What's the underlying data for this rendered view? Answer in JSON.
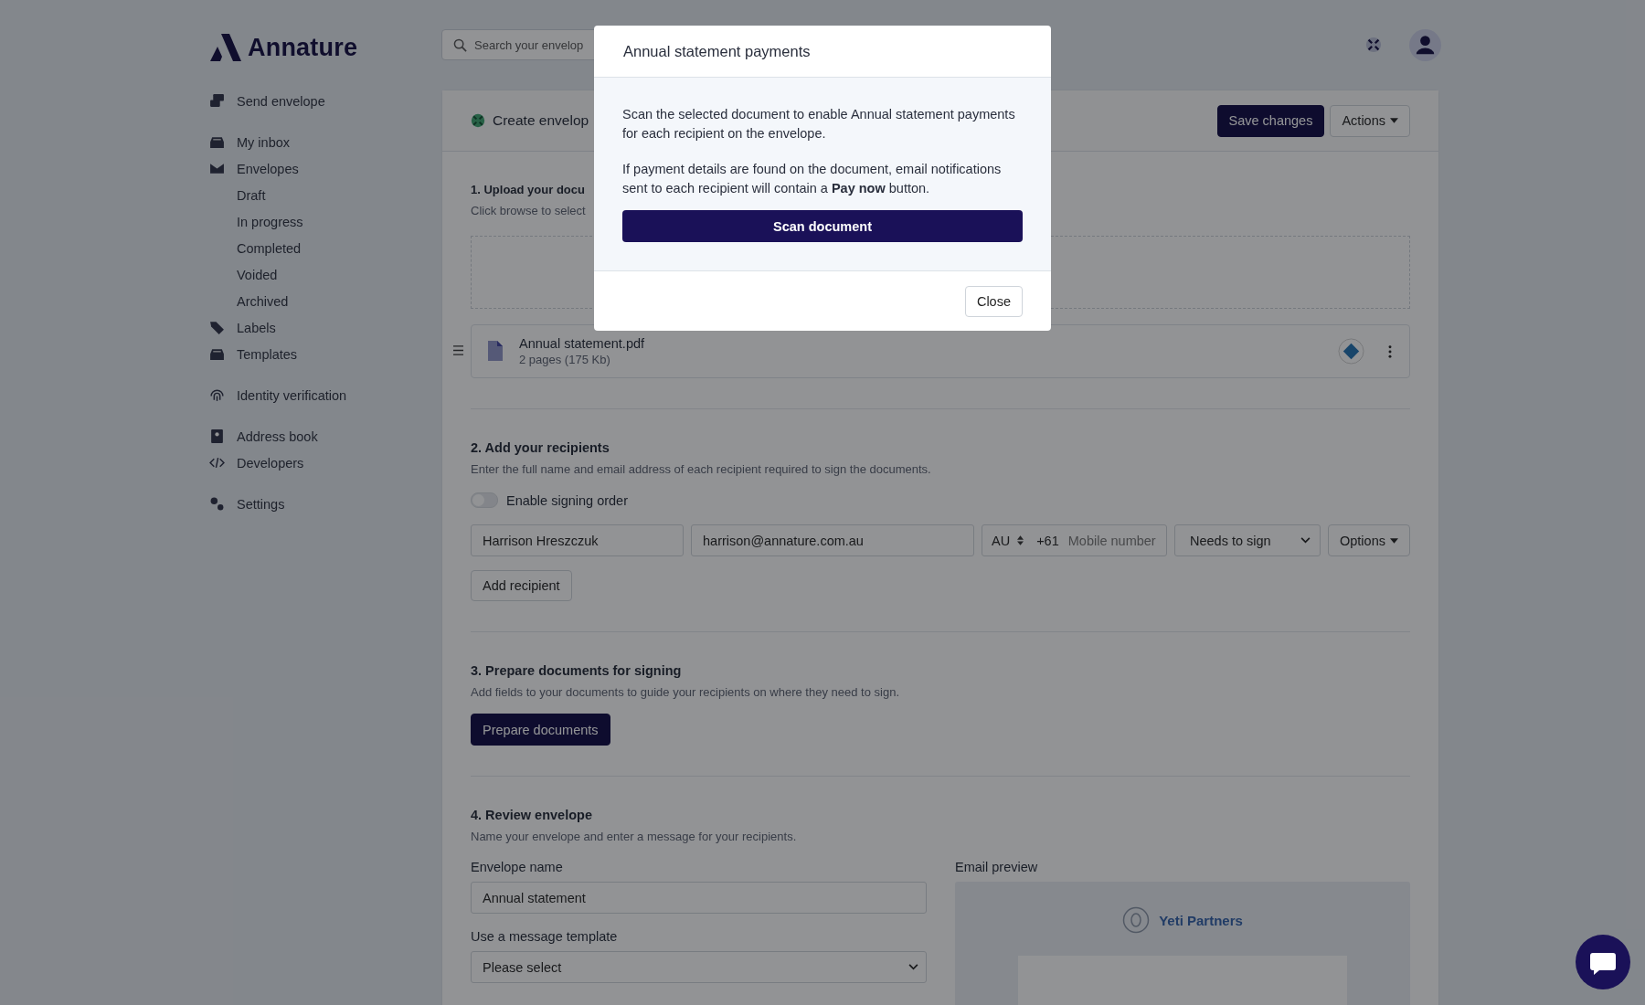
{
  "brand": {
    "name": "Annature"
  },
  "search": {
    "placeholder": "Search your envelop"
  },
  "sidebar": {
    "groups": [
      {
        "items": [
          {
            "label": "Send envelope"
          }
        ]
      },
      {
        "items": [
          {
            "label": "My inbox"
          },
          {
            "label": "Envelopes",
            "children": [
              {
                "label": "Draft"
              },
              {
                "label": "In progress"
              },
              {
                "label": "Completed"
              },
              {
                "label": "Voided"
              },
              {
                "label": "Archived"
              }
            ]
          },
          {
            "label": "Labels"
          },
          {
            "label": "Templates"
          }
        ]
      },
      {
        "items": [
          {
            "label": "Identity verification"
          }
        ]
      },
      {
        "items": [
          {
            "label": "Address book"
          },
          {
            "label": "Developers"
          }
        ]
      },
      {
        "items": [
          {
            "label": "Settings"
          }
        ]
      }
    ]
  },
  "header": {
    "title": "Create envelop",
    "buttons": [
      {
        "label": "Save changes",
        "kind": "primary"
      },
      {
        "label": "Actions",
        "kind": "dropdown"
      }
    ]
  },
  "upload": {
    "title": "1. Upload your docu",
    "subtitle": "Click browse to select",
    "file": {
      "name": "Annual statement.pdf",
      "meta": "2 pages (175 Kb)"
    }
  },
  "recipients": {
    "title": "2. Add your recipients",
    "subtitle": "Enter the full name and email address of each recipient required to sign the documents.",
    "signing_order": {
      "label": "Enable signing order",
      "on": false
    },
    "rows": [
      {
        "name": "Harrison Hreszczuk",
        "email": "harrison@annature.com.au",
        "country": "AU",
        "dial_code": "+61",
        "mobile_placeholder": "Mobile number",
        "role": "Needs to sign",
        "options": "Options"
      }
    ],
    "add_button": "Add recipient"
  },
  "prepare": {
    "title": "3. Prepare documents for signing",
    "subtitle": "Add fields to your documents to guide your recipients on where they need to sign.",
    "button": "Prepare documents"
  },
  "review": {
    "title": "4. Review envelope",
    "subtitle": "Name your envelope and enter a message for your recipients.",
    "name_label": "Envelope name",
    "name_value": "Annual statement",
    "template_label": "Use a message template",
    "template_value": "Please select",
    "preview_label": "Email preview",
    "preview_sender": "Yeti Partners"
  },
  "modal": {
    "title": "Annual statement payments",
    "paragraphs": [
      "Scan the selected document to enable Annual statement payments for each recipient on the envelope.",
      "If payment details are found on the document, email notifications sent to each recipient will contain a **Pay now** button."
    ],
    "primary_button": "Scan document",
    "close_button": "Close"
  }
}
